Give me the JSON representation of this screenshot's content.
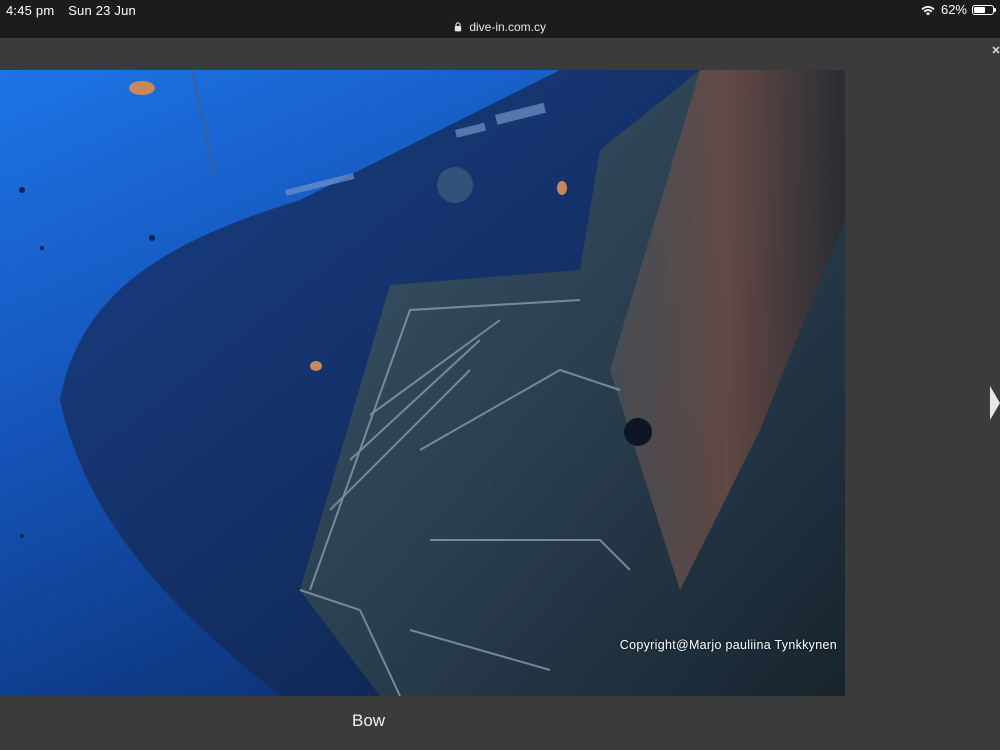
{
  "status_bar": {
    "time": "4:45 pm",
    "date": "Sun 23 Jun",
    "battery_percent": "62%",
    "battery_level": 0.62
  },
  "browser": {
    "url": "dive-in.com.cy"
  },
  "gallery": {
    "copyright": "Copyright@Marjo pauliina Tynkkynen",
    "caption": "Bow"
  },
  "colors": {
    "chrome": "#1c1c1c",
    "page_bg": "#3b3b3b",
    "sea_light": "#1a6ad8",
    "sea_dark": "#0a2a5c"
  },
  "icons": {
    "wifi": "wifi-icon",
    "battery": "battery-icon",
    "lock": "lock-icon",
    "close": "close-icon",
    "next": "chevron-right-icon"
  }
}
